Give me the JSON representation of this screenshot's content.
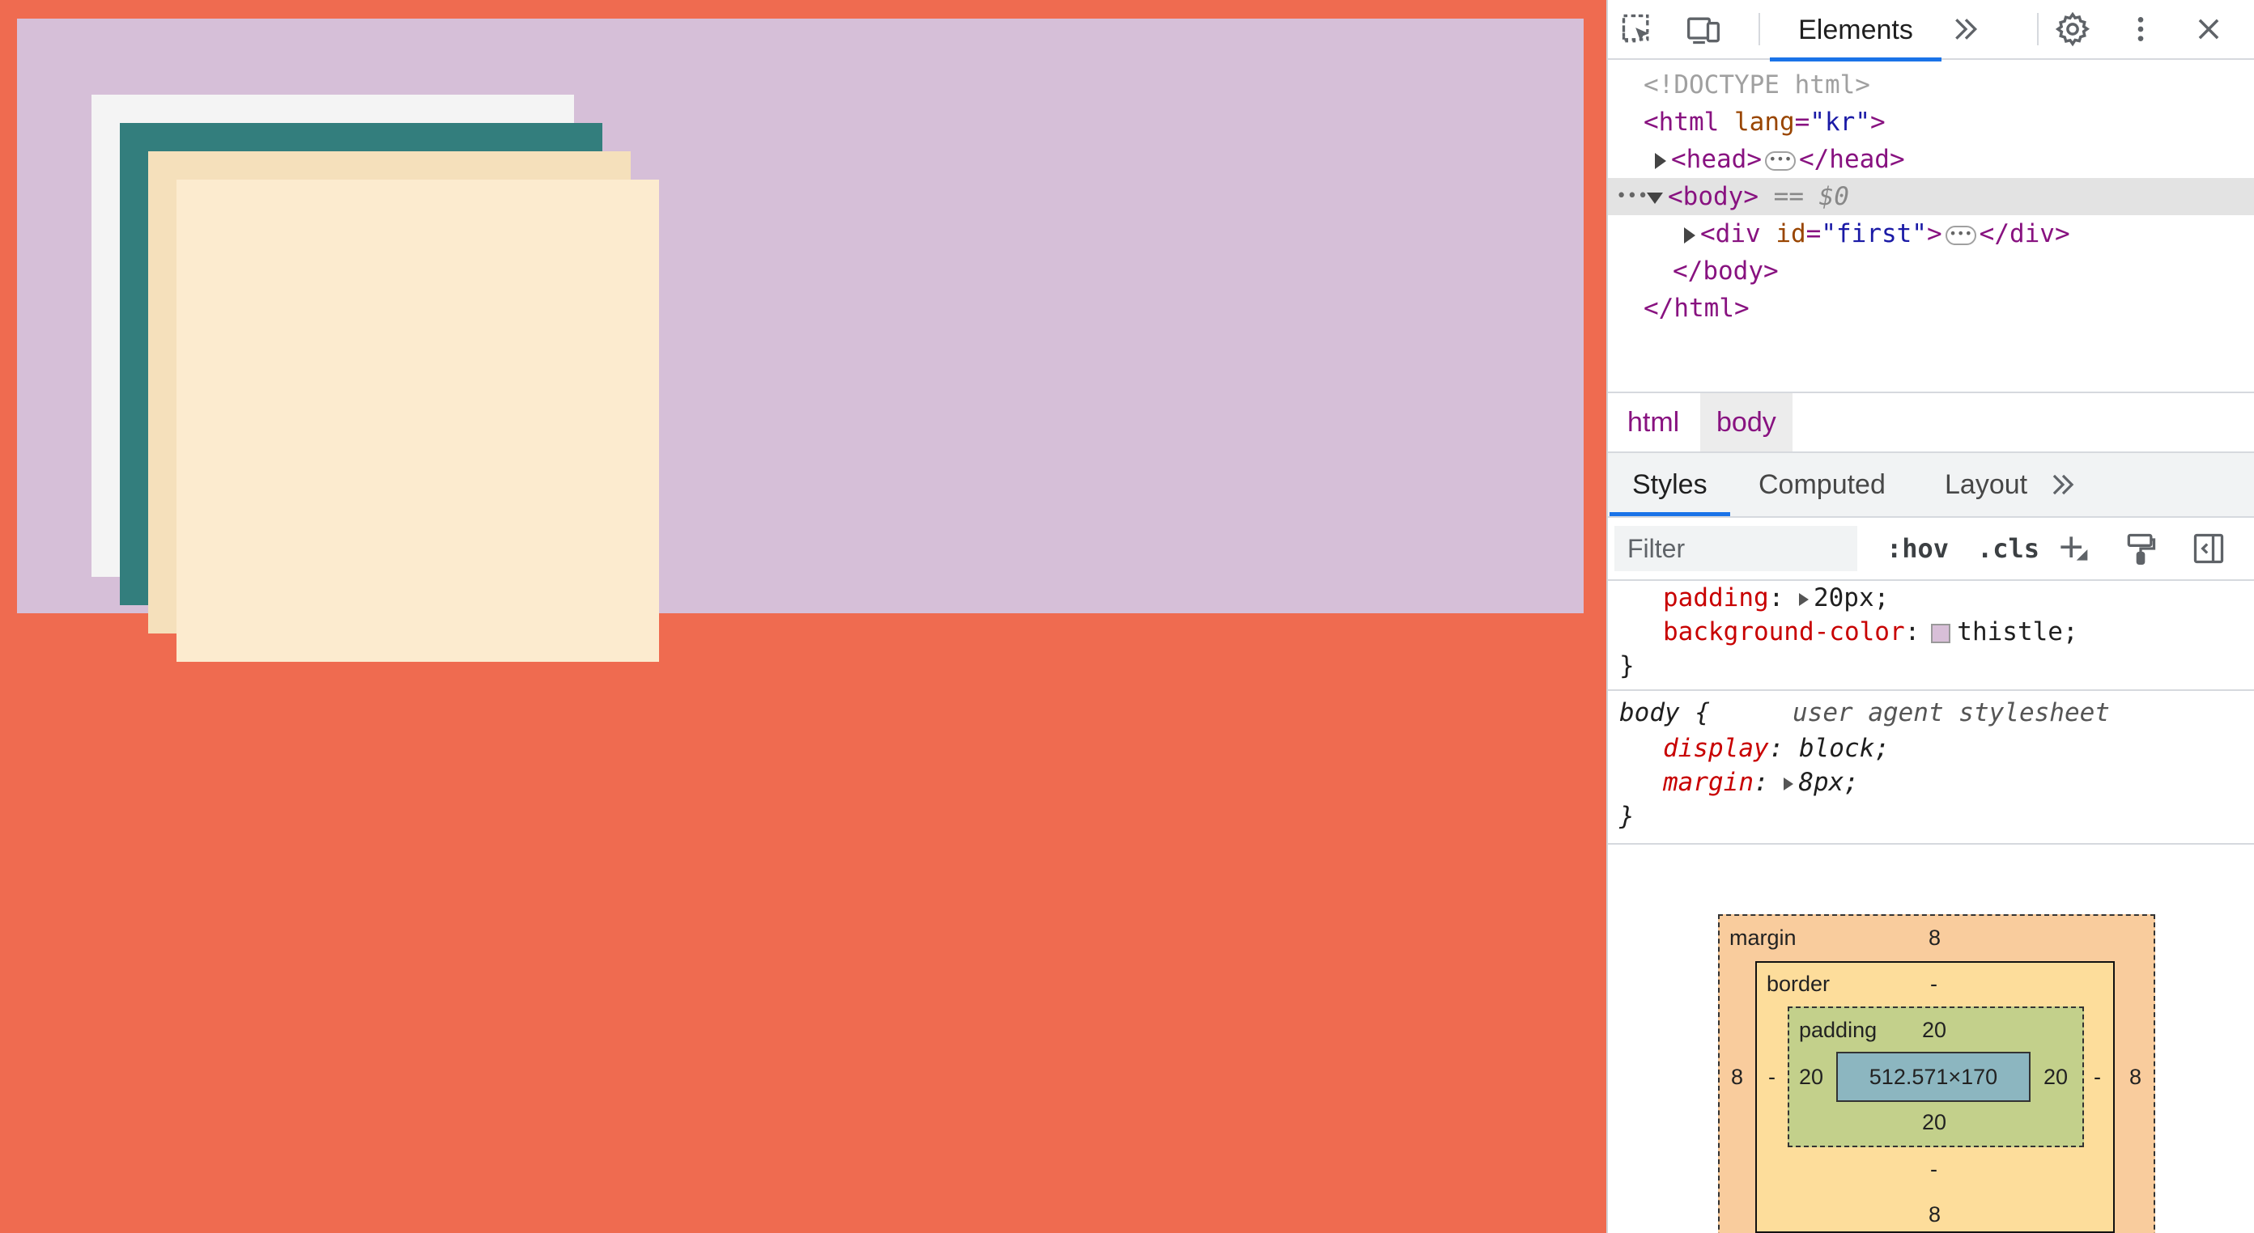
{
  "viewport": {
    "colors": {
      "body_background": "#ef6b50",
      "div_first_background": "thistle",
      "squares": [
        "#f4f4f4",
        "#337e7d",
        "#f5e0bb",
        "#fcebcf"
      ]
    }
  },
  "devtools": {
    "toolbar": {
      "inspect_icon": "inspect-element-icon",
      "device_icon": "device-toolbar-icon",
      "elements_tab": "Elements",
      "more_tabs_icon": "chevron-double-right-icon",
      "settings_icon": "gear-icon",
      "menu_icon": "kebab-menu-icon",
      "close_icon": "close-icon"
    },
    "dom": {
      "doctype": "<!DOCTYPE html>",
      "html_open_tag": "<html",
      "html_attr_name": "lang",
      "html_attr_value": "\"kr\"",
      "html_open_close": ">",
      "head_open": "<head>",
      "head_close": "</head>",
      "body_open": "<body>",
      "selected_marker": "== $0",
      "div_open_tag": "<div",
      "div_attr_name": "id",
      "div_attr_value": "\"first\"",
      "div_open_close": ">",
      "div_close": "</div>",
      "body_close": "</body>",
      "html_close": "</html>",
      "ellipsis": "•••",
      "row_menu": "•••"
    },
    "breadcrumbs": [
      "html",
      "body"
    ],
    "subtabs": [
      "Styles",
      "Computed",
      "Layout"
    ],
    "filter": {
      "placeholder": "Filter",
      "hov": ":hov",
      "cls": ".cls"
    },
    "styles": {
      "rule1": {
        "padding_prop": "padding",
        "padding_val": "20px;",
        "bg_prop": "background-color",
        "bg_val": "thistle;",
        "close": "}"
      },
      "rule2": {
        "selector": "body {",
        "source": "user agent stylesheet",
        "display_prop": "display",
        "display_val": "block;",
        "margin_prop": "margin",
        "margin_val": "8px;",
        "close": "}"
      }
    },
    "box_model": {
      "margin_label": "margin",
      "margin_top": "8",
      "margin_right": "8",
      "margin_bottom": "8",
      "margin_left": "8",
      "border_label": "border",
      "border_top": "-",
      "border_right": "-",
      "border_bottom": "-",
      "border_left": "-",
      "padding_label": "padding",
      "padding_top": "20",
      "padding_right": "20",
      "padding_bottom": "20",
      "padding_left": "20",
      "content_size": "512.571×170"
    }
  }
}
